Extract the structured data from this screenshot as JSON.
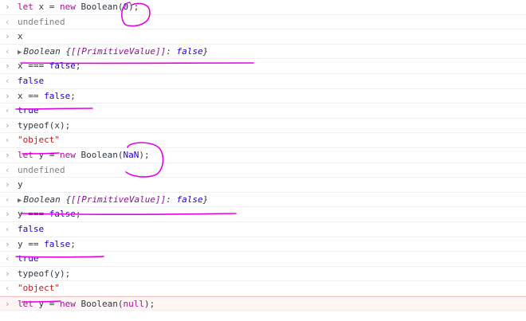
{
  "console": {
    "entries": [
      {
        "kind": "in",
        "parts": [
          [
            "kw",
            "let"
          ],
          [
            "t",
            " x = "
          ],
          [
            "kw",
            "new"
          ],
          [
            "t",
            " Boolean("
          ],
          [
            "num",
            "0"
          ],
          [
            "t",
            ");"
          ]
        ]
      },
      {
        "kind": "out",
        "parts": [
          [
            "undef",
            "undefined"
          ]
        ]
      },
      {
        "kind": "in",
        "parts": [
          [
            "t",
            "x"
          ]
        ]
      },
      {
        "kind": "obj",
        "parts": [
          [
            "obj",
            "Boolean {"
          ],
          [
            "pv",
            "[[PrimitiveValue]]"
          ],
          [
            "t",
            ": "
          ],
          [
            "pvv",
            "false"
          ],
          [
            "obj",
            "}"
          ]
        ]
      },
      {
        "kind": "in",
        "parts": [
          [
            "t",
            "x === "
          ],
          [
            "bool",
            "false"
          ],
          [
            "t",
            ";"
          ]
        ]
      },
      {
        "kind": "out",
        "parts": [
          [
            "bool",
            "false"
          ]
        ]
      },
      {
        "kind": "in",
        "parts": [
          [
            "t",
            "x == "
          ],
          [
            "bool",
            "false"
          ],
          [
            "t",
            ";"
          ]
        ]
      },
      {
        "kind": "out",
        "parts": [
          [
            "bool",
            "true"
          ]
        ]
      },
      {
        "kind": "in",
        "parts": [
          [
            "t",
            "typeof(x);"
          ]
        ]
      },
      {
        "kind": "out",
        "parts": [
          [
            "str",
            "\"object\""
          ]
        ]
      },
      {
        "kind": "in",
        "parts": [
          [
            "kw",
            "let"
          ],
          [
            "t",
            " y = "
          ],
          [
            "kw",
            "new"
          ],
          [
            "t",
            " Boolean("
          ],
          [
            "num",
            "NaN"
          ],
          [
            "t",
            ");"
          ]
        ]
      },
      {
        "kind": "out",
        "parts": [
          [
            "undef",
            "undefined"
          ]
        ]
      },
      {
        "kind": "in",
        "parts": [
          [
            "t",
            "y"
          ]
        ]
      },
      {
        "kind": "obj",
        "parts": [
          [
            "obj",
            "Boolean {"
          ],
          [
            "pv",
            "[[PrimitiveValue]]"
          ],
          [
            "t",
            ": "
          ],
          [
            "pvv",
            "false"
          ],
          [
            "obj",
            "}"
          ]
        ]
      },
      {
        "kind": "in",
        "parts": [
          [
            "t",
            "y === "
          ],
          [
            "bool",
            "false"
          ],
          [
            "t",
            ";"
          ]
        ]
      },
      {
        "kind": "out",
        "parts": [
          [
            "bool",
            "false"
          ]
        ]
      },
      {
        "kind": "in",
        "parts": [
          [
            "t",
            "y == "
          ],
          [
            "bool",
            "false"
          ],
          [
            "t",
            ";"
          ]
        ]
      },
      {
        "kind": "out",
        "parts": [
          [
            "bool",
            "true"
          ]
        ]
      },
      {
        "kind": "in",
        "parts": [
          [
            "t",
            "typeof(y);"
          ]
        ]
      },
      {
        "kind": "out",
        "parts": [
          [
            "str",
            "\"object\""
          ]
        ]
      },
      {
        "kind": "in",
        "parts": [
          [
            "kw",
            "let"
          ],
          [
            "t",
            " y = "
          ],
          [
            "kw",
            "new"
          ],
          [
            "t",
            " Boolean("
          ],
          [
            "kw",
            "null"
          ],
          [
            "t",
            ");"
          ]
        ]
      }
    ]
  },
  "glyphs": {
    "in": "›",
    "out": "‹",
    "expand": "▶"
  },
  "colors": {
    "annotation": "#e600e6",
    "keyword": "#aa0d91",
    "number": "#1c00cf",
    "string": "#c41a16"
  }
}
